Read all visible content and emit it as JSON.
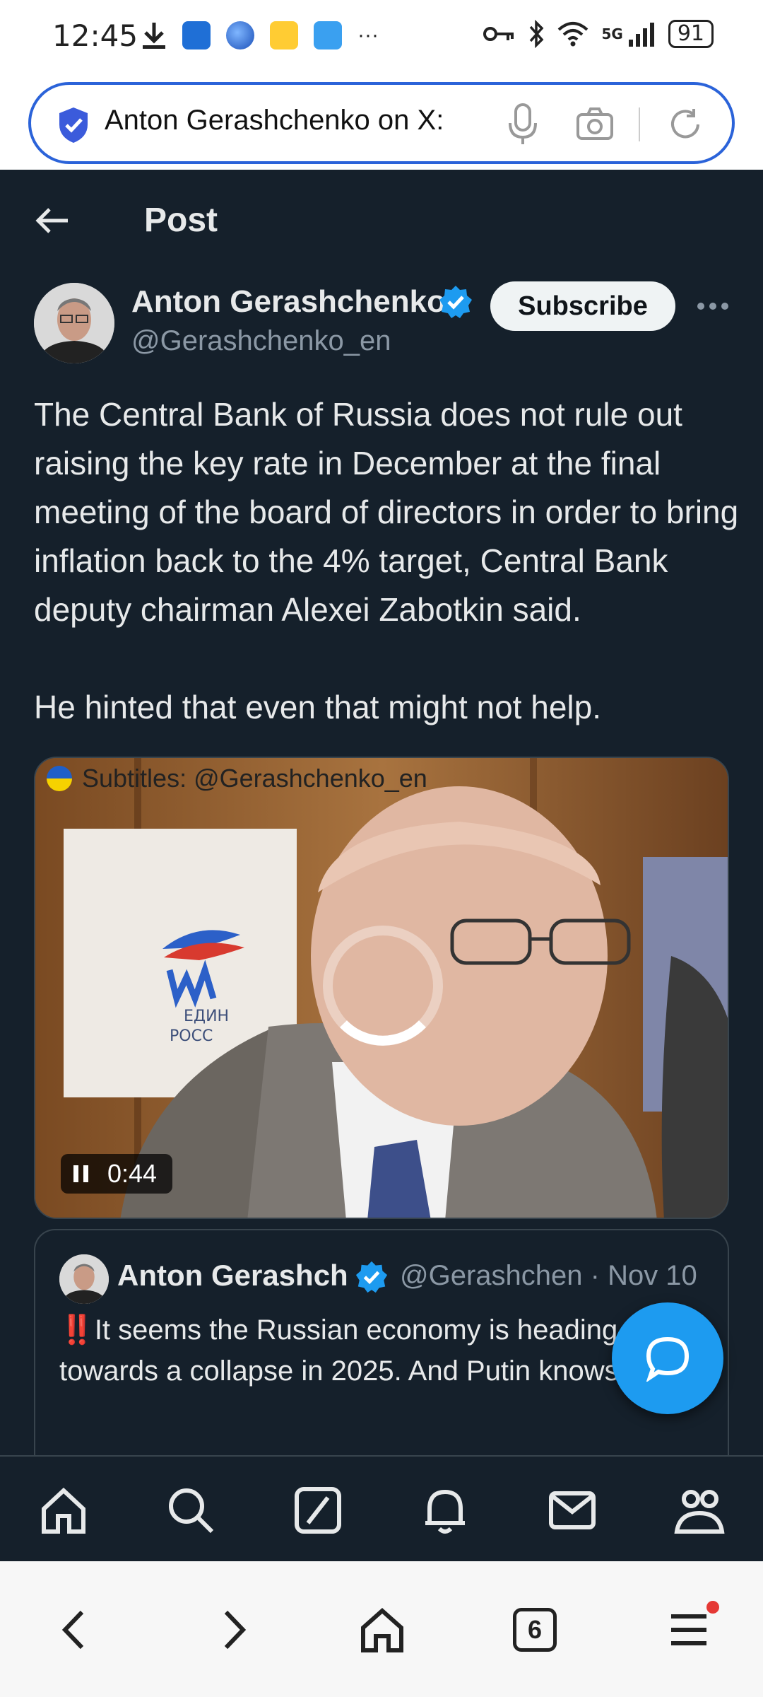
{
  "status_bar": {
    "time": "12:45",
    "overflow": "···",
    "network": "5G",
    "battery": "91",
    "icons": [
      "download-icon",
      "app-icon-blue",
      "app-icon-globe",
      "app-icon-weibo",
      "app-icon-weather",
      "key-icon",
      "bluetooth-icon",
      "wifi-icon",
      "signal-icon"
    ]
  },
  "url_bar": {
    "text": "Anton Gerashchenko on X:"
  },
  "header": {
    "title": "Post"
  },
  "post": {
    "author_name": "Anton Gerashchenko",
    "author_handle": "@Gerashchenko_en",
    "subscribe_label": "Subscribe",
    "text_1": "The Central Bank of Russia does not rule out raising the key rate in December at the final meeting of the board of directors in order to bring inflation back to the 4% target, Central Bank deputy chairman Alexei Zabotkin said.",
    "text_2": "He hinted that even that might not help."
  },
  "video": {
    "subtitle_text": "Subtitles: @Gerashchenko_en",
    "time": "0:44",
    "logo_text_1": "ЕДИН",
    "logo_text_2": "РОСС"
  },
  "quoted_post": {
    "author_name": "Anton Gerashch",
    "handle_date": "@Gerashchen · Nov 10",
    "bang": "‼️",
    "text": "It seems the Russian economy is heading towards a collapse in 2025. And Putin knows this."
  },
  "bottom_nav": {
    "items": [
      "home-icon",
      "search-icon",
      "grok-icon",
      "notifications-icon",
      "messages-icon",
      "communities-icon"
    ]
  },
  "browser_bar": {
    "tab_count": "6"
  },
  "colors": {
    "background": "#15202b",
    "accent": "#1d9bf0",
    "url_border": "#2b63d9"
  }
}
